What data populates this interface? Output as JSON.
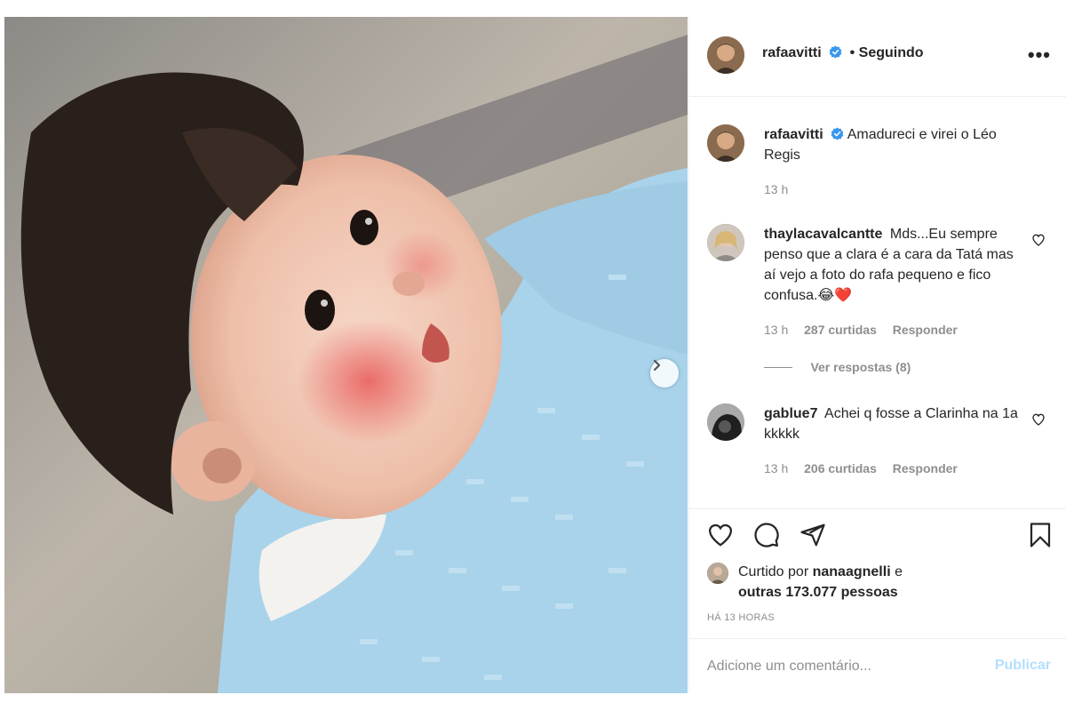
{
  "post": {
    "author": "rafaavitti",
    "follow_status": "• Seguindo",
    "more_label": "•••"
  },
  "caption": {
    "username": "rafaavitti",
    "text": "Amadureci e virei o Léo Regis",
    "time": "13 h"
  },
  "comments": [
    {
      "username": "thaylacavalcantte",
      "text": "Mds...Eu sempre penso que a clara é a cara da Tatá mas aí vejo a foto do rafa pequeno e fico confusa.😂❤️",
      "time": "13 h",
      "likes": "287 curtidas",
      "reply": "Responder",
      "view_replies": "Ver respostas (8)"
    },
    {
      "username": "gablue7",
      "text": "Achei q fosse a Clarinha na 1a kkkkk",
      "time": "13 h",
      "likes": "206 curtidas",
      "reply": "Responder"
    }
  ],
  "likes": {
    "prefix": "Curtido por",
    "user": "nanaagnelli",
    "conjunction": "e",
    "others": "outras 173.077 pessoas"
  },
  "timestamp": "HÁ 13 HORAS",
  "add_comment": {
    "placeholder": "Adicione um comentário...",
    "publish": "Publicar"
  },
  "colors": {
    "verified": "#3897f0",
    "text": "#262626",
    "muted": "#8e8e8e",
    "publish_disabled": "#b2dffc"
  },
  "icons": [
    "verified-badge-icon",
    "more-options-icon",
    "heart-icon",
    "comment-icon",
    "share-icon",
    "bookmark-icon",
    "chevron-right-icon"
  ]
}
